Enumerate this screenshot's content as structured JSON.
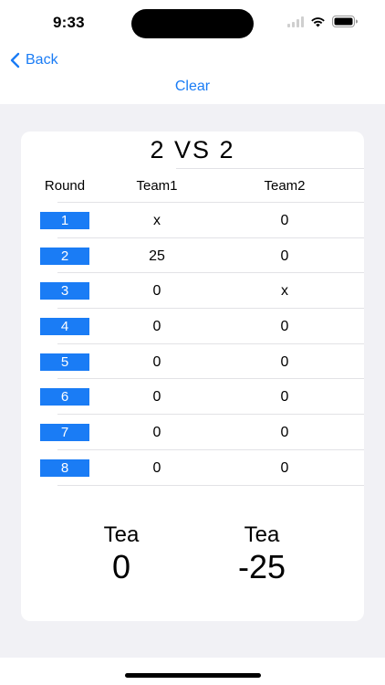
{
  "status_bar": {
    "time": "9:33",
    "icons": [
      "cellular-signal-icon",
      "wifi-icon",
      "battery-icon"
    ]
  },
  "nav": {
    "back_label": "Back",
    "clear_label": "Clear",
    "accent_color": "#1a7cf5"
  },
  "match": {
    "title": "2 VS 2",
    "headers": {
      "round": "Round",
      "team1": "Team1",
      "team2": "Team2"
    },
    "rounds": [
      {
        "round": "1",
        "team1": "x",
        "team2": "0"
      },
      {
        "round": "2",
        "team1": "25",
        "team2": "0"
      },
      {
        "round": "3",
        "team1": "0",
        "team2": "x"
      },
      {
        "round": "4",
        "team1": "0",
        "team2": "0"
      },
      {
        "round": "5",
        "team1": "0",
        "team2": "0"
      },
      {
        "round": "6",
        "team1": "0",
        "team2": "0"
      },
      {
        "round": "7",
        "team1": "0",
        "team2": "0"
      },
      {
        "round": "8",
        "team1": "0",
        "team2": "0"
      }
    ],
    "totals": {
      "team1_label": "Tea",
      "team1_value": "0",
      "team2_label": "Tea",
      "team2_value": "-25"
    }
  }
}
